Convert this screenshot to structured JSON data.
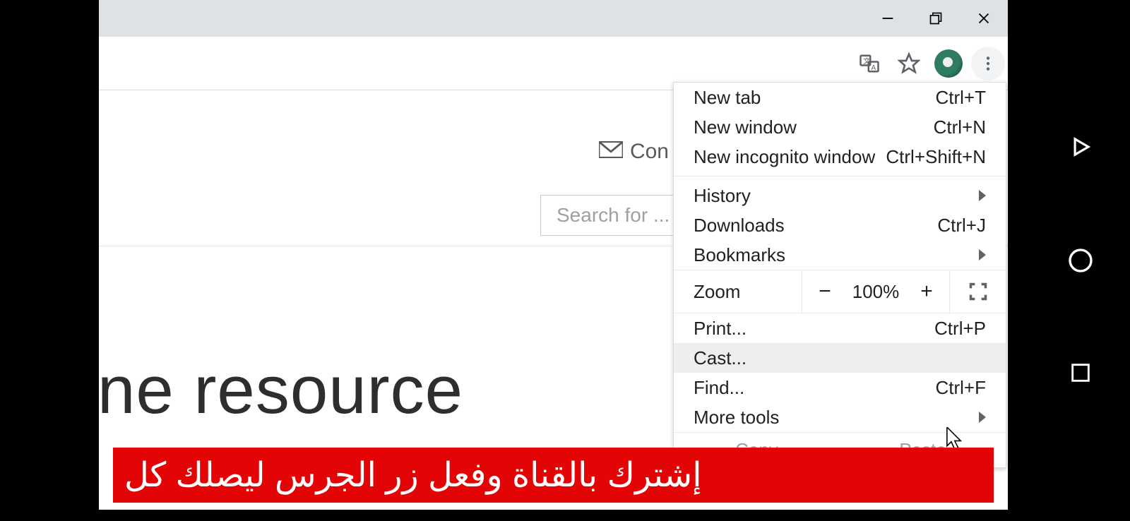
{
  "window_controls": {
    "minimize": "—",
    "maximize": "❐",
    "close": "✕"
  },
  "toolbar": {
    "translate_icon": "translate-icon",
    "star_icon": "star-icon",
    "kebab_icon": "kebab-menu-icon"
  },
  "page": {
    "contact_label": "Con",
    "search_placeholder": "Search for ...",
    "heading_fragment": "ne resource"
  },
  "menu": {
    "items": [
      {
        "label": "New tab",
        "shortcut": "Ctrl+T"
      },
      {
        "label": "New window",
        "shortcut": "Ctrl+N"
      },
      {
        "label": "New incognito window",
        "shortcut": "Ctrl+Shift+N"
      }
    ],
    "history": "History",
    "downloads": {
      "label": "Downloads",
      "shortcut": "Ctrl+J"
    },
    "bookmarks": "Bookmarks",
    "zoom": {
      "label": "Zoom",
      "minus": "−",
      "value": "100%",
      "plus": "+"
    },
    "print": {
      "label": "Print...",
      "shortcut": "Ctrl+P"
    },
    "cast": "Cast...",
    "find": {
      "label": "Find...",
      "shortcut": "Ctrl+F"
    },
    "more_tools": "More tools",
    "edit": {
      "copy": "Copy",
      "paste": "Paste"
    }
  },
  "ticker": {
    "text": "إشترك بالقناة وفعل زر الجرس ليصلك كل"
  }
}
